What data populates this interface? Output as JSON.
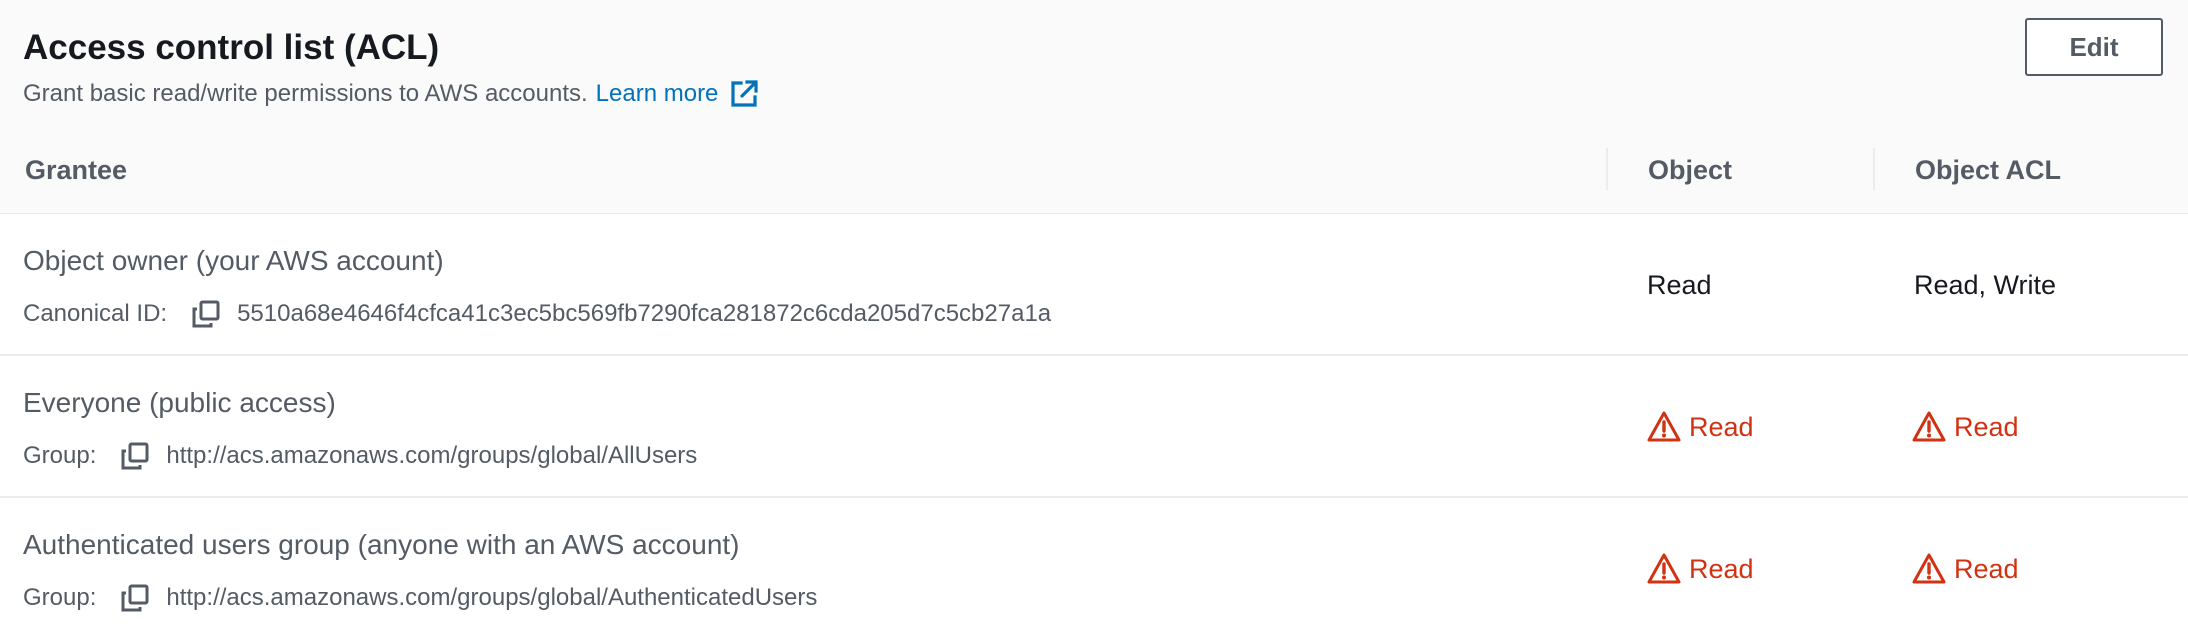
{
  "header": {
    "title": "Access control list (ACL)",
    "description": "Grant basic read/write permissions to AWS accounts.",
    "learn_more": "Learn more",
    "edit_label": "Edit"
  },
  "table": {
    "columns": [
      "Grantee",
      "Object",
      "Object ACL"
    ],
    "rows": [
      {
        "grantee": "Object owner (your AWS account)",
        "id_label": "Canonical ID:",
        "id_value": "5510a68e4646f4cfca41c3ec5bc569fb7290fca281872c6cda205d7c5cb27a1a",
        "object": "Read",
        "object_acl": "Read, Write"
      },
      {
        "grantee": "Everyone (public access)",
        "id_label": "Group:",
        "id_value": "http://acs.amazonaws.com/groups/global/AllUsers",
        "object": "Read",
        "object_acl": "Read"
      },
      {
        "grantee": "Authenticated users group (anyone with an AWS account)",
        "id_label": "Group:",
        "id_value": "http://acs.amazonaws.com/groups/global/AuthenticatedUsers",
        "object": "Read",
        "object_acl": "Read"
      }
    ]
  },
  "colors": {
    "link": "#0073bb",
    "warning": "#d13212",
    "text_secondary": "#545b64",
    "border": "#eaeded"
  },
  "icons": {
    "external_link": "external-link-icon",
    "copy": "copy-icon",
    "warning": "warning-icon"
  }
}
